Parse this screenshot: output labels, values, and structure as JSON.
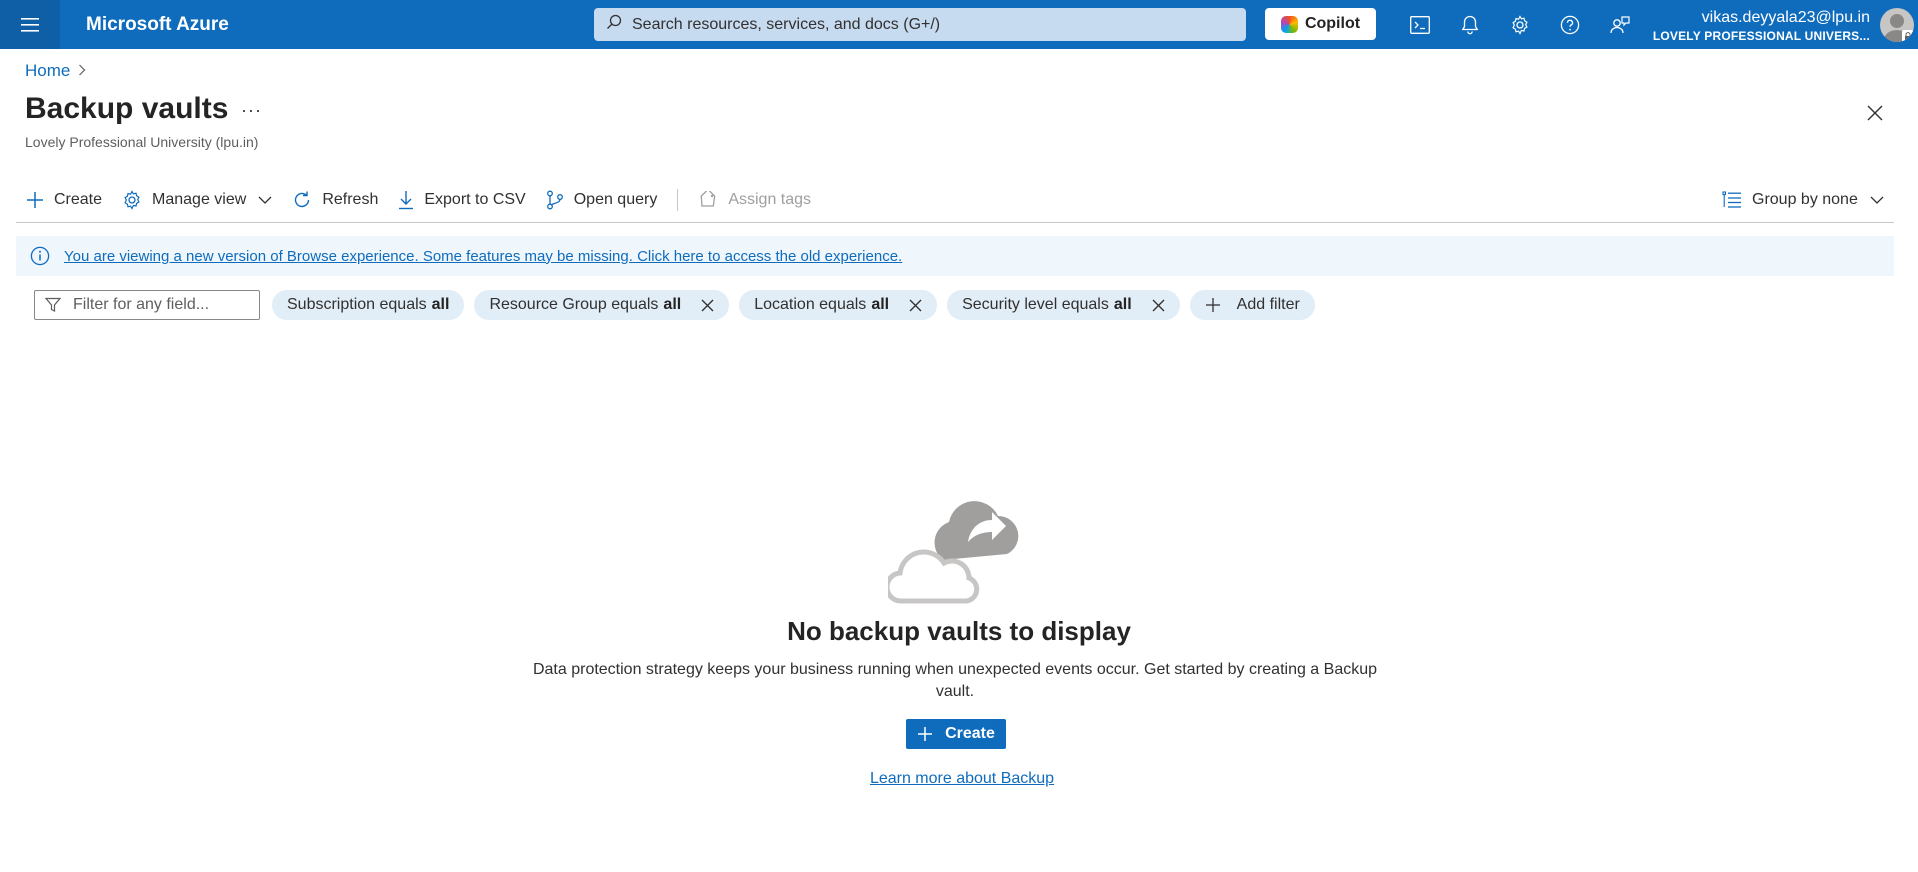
{
  "topbar": {
    "brand": "Microsoft Azure",
    "search_placeholder": "Search resources, services, and docs (G+/)",
    "copilot_label": "Copilot",
    "account_email": "vikas.deyyala23@lpu.in",
    "account_org": "LOVELY PROFESSIONAL UNIVERS...",
    "icons": [
      "hamburger-icon",
      "search-icon",
      "cloud-shell-icon",
      "bell-icon",
      "gear-icon",
      "help-icon",
      "feedback-icon"
    ]
  },
  "breadcrumb": {
    "home": "Home"
  },
  "page": {
    "title": "Backup vaults",
    "more": "···",
    "subtitle": "Lovely Professional University (lpu.in)"
  },
  "toolbar": {
    "create": "Create",
    "manage_view": "Manage view",
    "refresh": "Refresh",
    "export_csv": "Export to CSV",
    "open_query": "Open query",
    "assign_tags": "Assign tags",
    "group_by": "Group by none"
  },
  "banner": {
    "text": "You are viewing a new version of Browse experience. Some features may be missing. Click here to access the old experience."
  },
  "filters": {
    "placeholder": "Filter for any field...",
    "pills": [
      {
        "label": "Subscription equals",
        "value": "all"
      },
      {
        "label": "Resource Group equals",
        "value": "all"
      },
      {
        "label": "Location equals",
        "value": "all"
      },
      {
        "label": "Security level equals",
        "value": "all"
      }
    ],
    "add_filter": "Add filter"
  },
  "empty_state": {
    "title": "No backup vaults to display",
    "description": "Data protection strategy keeps your business running when unexpected events occur. Get started by creating a Backup vault.",
    "create_button": "Create",
    "learn_more": "Learn more about Backup"
  },
  "colors": {
    "brand_blue": "#0f6cbd",
    "banner_bg": "#eff6fc",
    "pill_bg": "#e1edf7"
  }
}
